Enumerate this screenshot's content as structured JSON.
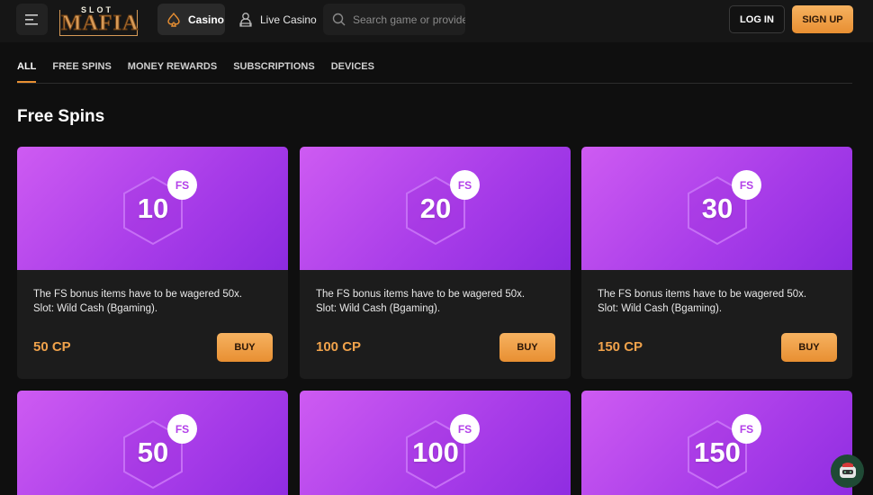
{
  "header": {
    "logo_small": "SLOT",
    "logo_big": "MAFIA",
    "nav": [
      {
        "label": "Casino",
        "icon": "spade-icon",
        "active": true
      },
      {
        "label": "Live Casino",
        "icon": "dealer-icon",
        "active": false
      }
    ],
    "search_placeholder": "Search game or provider",
    "login_label": "LOG IN",
    "signup_label": "SIGN UP"
  },
  "tabs": [
    "ALL",
    "FREE SPINS",
    "MONEY REWARDS",
    "SUBSCRIPTIONS",
    "DEVICES"
  ],
  "section_title": "Free Spins",
  "cards": [
    {
      "number": "10",
      "badge": "FS",
      "desc_line1": "The FS bonus items have to be wagered 50x.",
      "desc_line2": "Slot: Wild Cash (Bgaming).",
      "price": "50 CP",
      "buy_label": "BUY"
    },
    {
      "number": "20",
      "badge": "FS",
      "desc_line1": "The FS bonus items have to be wagered 50x.",
      "desc_line2": "Slot: Wild Cash (Bgaming).",
      "price": "100 CP",
      "buy_label": "BUY"
    },
    {
      "number": "30",
      "badge": "FS",
      "desc_line1": "The FS bonus items have to be wagered 50x.",
      "desc_line2": "Slot: Wild Cash (Bgaming).",
      "price": "150 CP",
      "buy_label": "BUY"
    },
    {
      "number": "50",
      "badge": "FS"
    },
    {
      "number": "100",
      "badge": "FS"
    },
    {
      "number": "150",
      "badge": "FS"
    }
  ],
  "colors": {
    "accent": "#e88f32",
    "card_purple": "#a63be8",
    "background": "#0f0f0f"
  }
}
